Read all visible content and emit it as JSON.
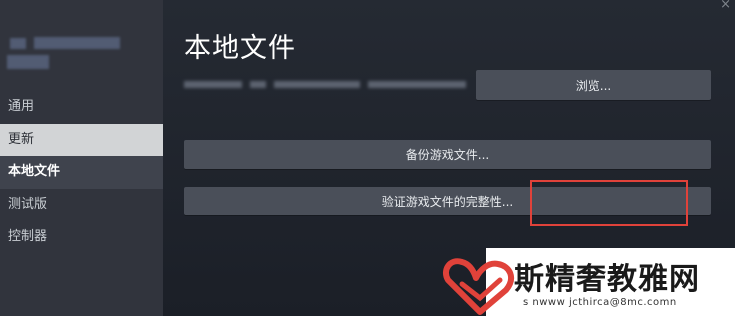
{
  "window": {
    "close_glyph": "×"
  },
  "sidebar": {
    "items": [
      {
        "label": "通用",
        "state": "normal"
      },
      {
        "label": "更新",
        "state": "hover"
      },
      {
        "label": "本地文件",
        "state": "selected"
      },
      {
        "label": "测试版",
        "state": "normal"
      },
      {
        "label": "控制器",
        "state": "normal"
      }
    ]
  },
  "main": {
    "title": "本地文件",
    "browse_label": "浏览...",
    "backup_label": "备份游戏文件...",
    "verify_label": "验证游戏文件的完整性..."
  },
  "watermark": {
    "site_name": "斯精奢教雅网",
    "url": "s nwww jcthirca@8mc.comn"
  },
  "colors": {
    "highlight_border": "#e0423a",
    "watermark_logo": "#e0423a",
    "sidebar_bg": "#31343d",
    "main_bg": "#1e222a",
    "button_bg": "#4a4f59"
  },
  "icons": {
    "close": "close-icon",
    "watermark_logo": "heart-logo-icon"
  }
}
